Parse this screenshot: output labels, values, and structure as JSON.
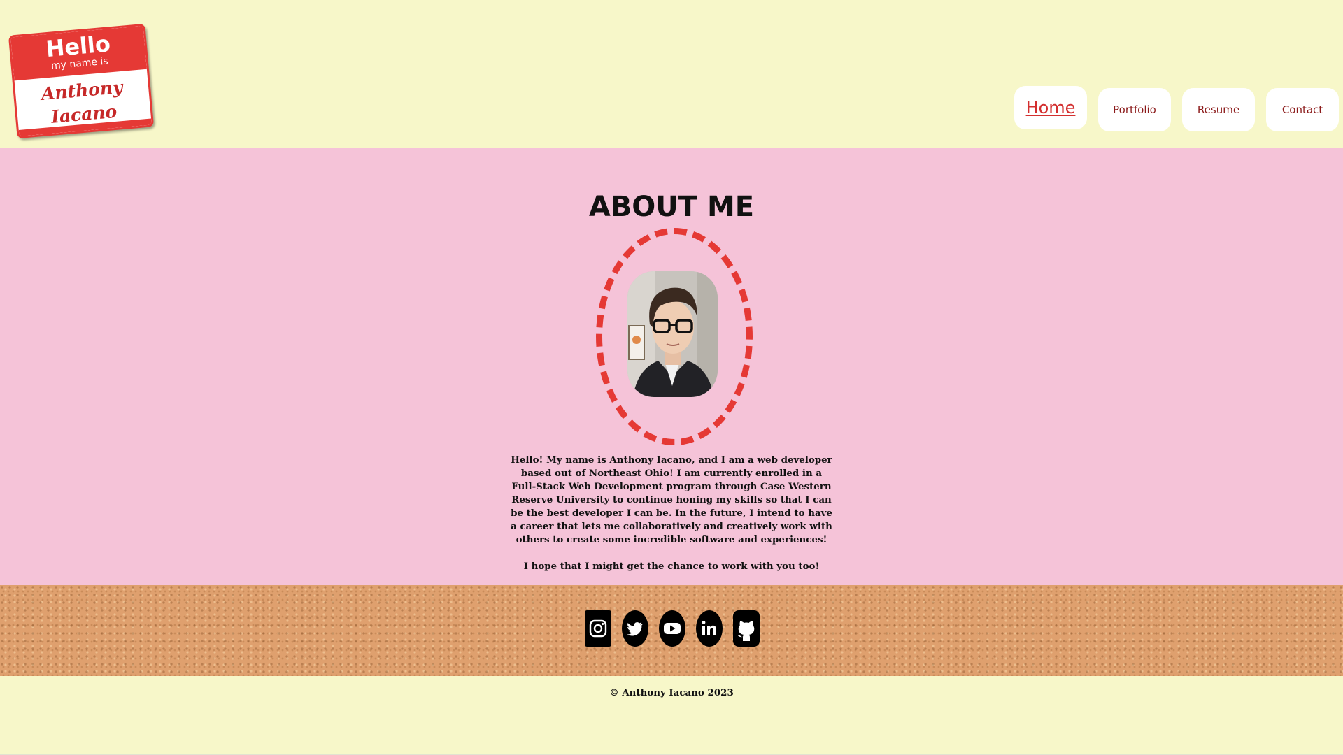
{
  "header": {
    "name_tag": {
      "hello": "Hello",
      "sub": "my name is",
      "first_name": "Anthony",
      "last_name": "Iacano"
    },
    "nav": [
      {
        "label": "Home",
        "active": true
      },
      {
        "label": "Portfolio",
        "active": false
      },
      {
        "label": "Resume",
        "active": false
      },
      {
        "label": "Contact",
        "active": false
      }
    ]
  },
  "about": {
    "title": "ABOUT ME",
    "bio": "Hello! My name is Anthony Iacano, and I am a web developer based out of Northeast Ohio! I am currently enrolled in a Full-Stack Web Development program through Case Western Reserve University to continue honing my skills so that I can be the best developer I can be. In the future, I intend to have a career that lets me collaboratively and creatively work with others to create some incredible software and experiences!",
    "closing": "I hope that I might get the chance to work with you too!"
  },
  "social": [
    {
      "name": "instagram-icon"
    },
    {
      "name": "twitter-icon"
    },
    {
      "name": "youtube-icon"
    },
    {
      "name": "linkedin-icon"
    },
    {
      "name": "github-icon"
    }
  ],
  "footer": {
    "copyright": "© Anthony Iacano 2023"
  },
  "colors": {
    "header_bg": "#f7f7c9",
    "about_bg": "#f5c3d8",
    "accent_red": "#e53935",
    "cork": "#dfa06e"
  }
}
